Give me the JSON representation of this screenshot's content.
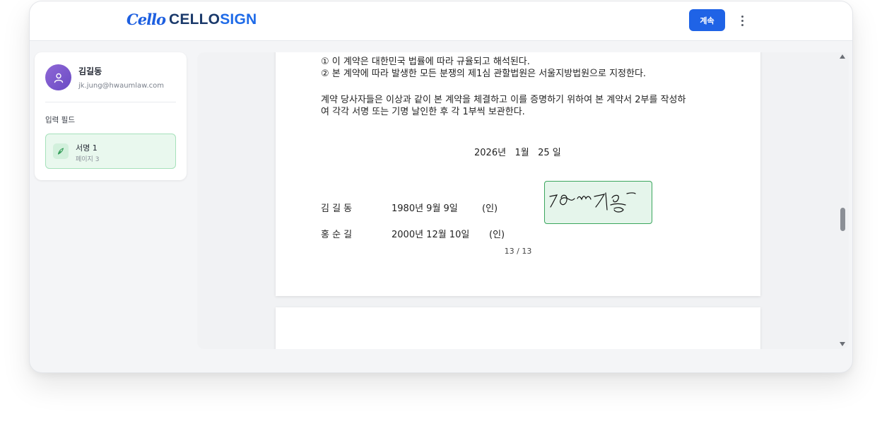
{
  "header": {
    "logo_script": "Cello",
    "logo_cello": "CELLO",
    "logo_sign": "SIGN",
    "continue_label": "계속",
    "more_icon": "more-vertical-icon"
  },
  "sidebar": {
    "user_name": "김길동",
    "user_email": "jk.jung@hwaumlaw.com",
    "fields_heading": "입력 필드",
    "fields": [
      {
        "label": "서명 1",
        "page": "페이지 3",
        "icon": "pen-icon"
      }
    ]
  },
  "document": {
    "lines": [
      "① 이 계약은 대한민국 법률에 따라 규율되고 해석된다.",
      "② 본 계약에 따라 발생한 모든 분쟁의 제1심 관할법원은 서울지방법원으로 지정한다.",
      "계약 당사자들은 이상과 같이 본 계약을 체결하고 이를 증명하기 위하여 본 계약서 2부를 작성하",
      "여 각각 서명 또는 기명 날인한 후 각 1부씩 보관한다."
    ],
    "date": "2026년   1월   25 일",
    "parties": [
      {
        "name": "김 길 동",
        "dob": "1980년 9월 9일",
        "seal": "(인)"
      },
      {
        "name": "홍 순 길",
        "dob": "2000년 12월 10일",
        "seal": "(인)"
      }
    ],
    "page_number": "13 / 13"
  },
  "colors": {
    "primary": "#1f63e6",
    "signature_green": "#3aa65d",
    "avatar": "#7b57cc"
  }
}
